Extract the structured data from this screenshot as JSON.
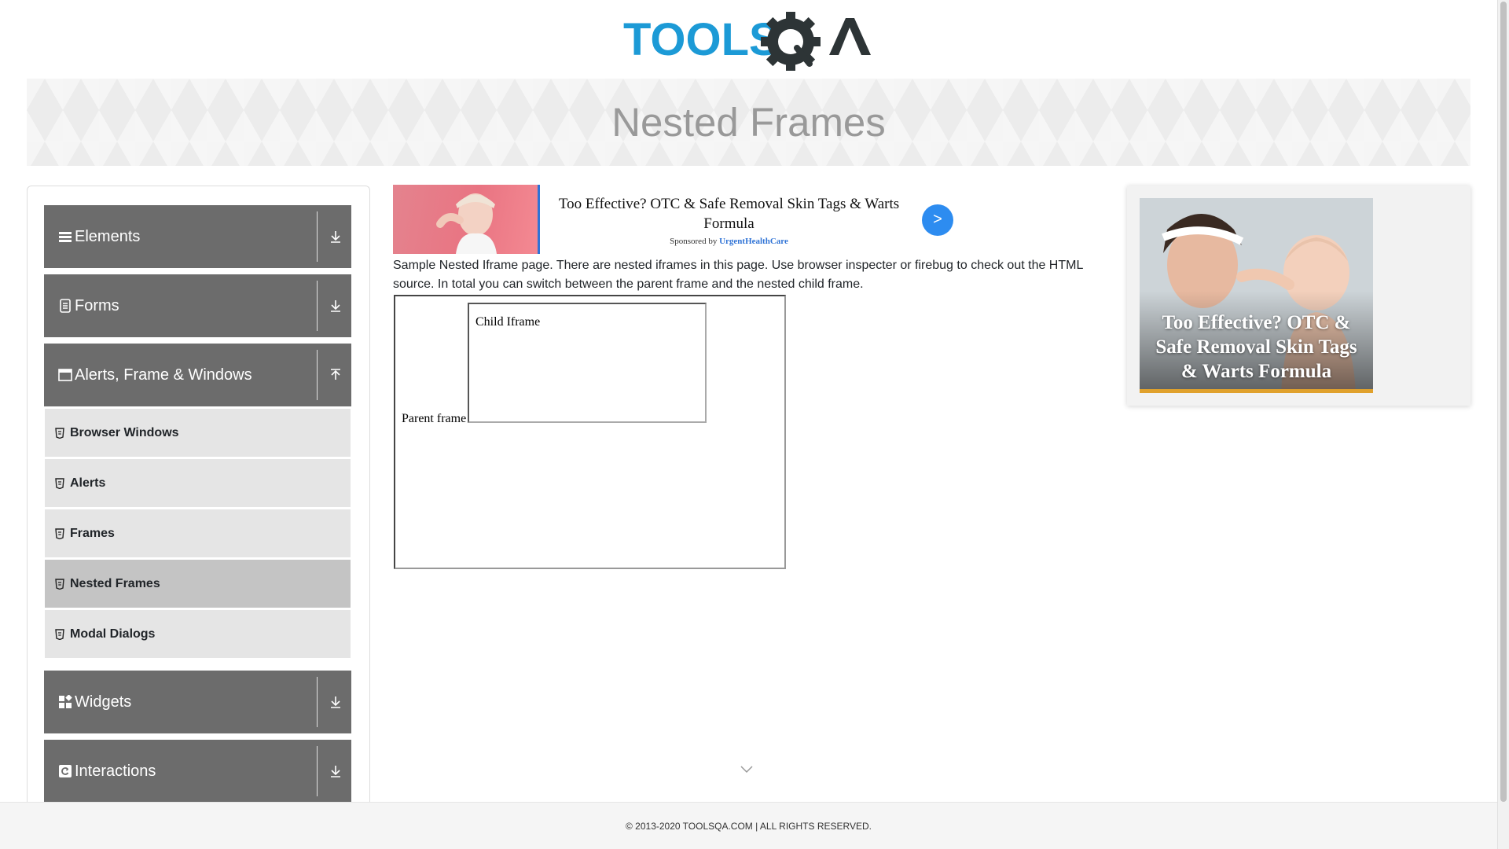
{
  "logo": {
    "text_tools": "TOOLS",
    "text_qa": "QA"
  },
  "page": {
    "title": "Nested Frames"
  },
  "sidebar": {
    "groups": [
      {
        "label": "Elements",
        "icon": "list-icon",
        "expanded": false
      },
      {
        "label": "Forms",
        "icon": "document-icon",
        "expanded": false
      },
      {
        "label": "Alerts, Frame & Windows",
        "icon": "window-icon",
        "expanded": true
      },
      {
        "label": "Widgets",
        "icon": "grid-icon",
        "expanded": false
      },
      {
        "label": "Interactions",
        "icon": "refresh-icon",
        "expanded": false
      }
    ],
    "sub_items": [
      {
        "label": "Browser Windows",
        "active": false
      },
      {
        "label": "Alerts",
        "active": false
      },
      {
        "label": "Frames",
        "active": false
      },
      {
        "label": "Nested Frames",
        "active": true
      },
      {
        "label": "Modal Dialogs",
        "active": false
      }
    ]
  },
  "ad_top": {
    "title": "Too Effective? OTC & Safe Removal Skin Tags & Warts Formula",
    "sponsored_prefix": "Sponsored by",
    "sponsor": "UrgentHealthCare",
    "button": ">"
  },
  "content": {
    "description": "Sample Nested Iframe page. There are nested iframes in this page. Use browser inspecter or firebug to check out the HTML source. In total you can switch between the parent frame and the nested child frame.",
    "parent_frame_text": "Parent frame",
    "child_frame_text": "Child Iframe"
  },
  "ad_right": {
    "title": "Too Effective? OTC & Safe Removal Skin Tags & Warts Formula"
  },
  "footer": {
    "text": "© 2013-2020 TOOLSQA.COM | ALL RIGHTS RESERVED."
  },
  "colors": {
    "brand_blue": "#1c9ad6",
    "brand_dark": "#2d3436",
    "sidebar_group": "#6c6c6c",
    "sidebar_sub": "#e5e5e5",
    "sidebar_active": "#c4c4c4",
    "ad_button": "#2d8cf0"
  }
}
